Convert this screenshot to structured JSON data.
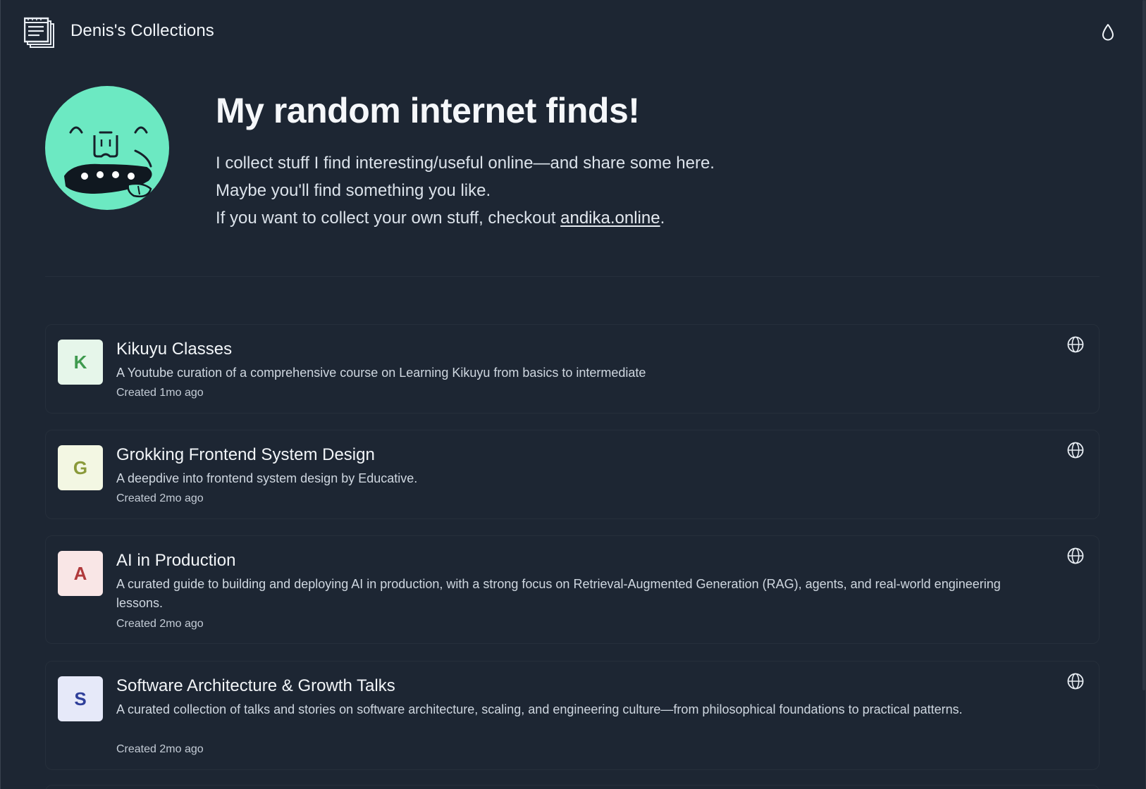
{
  "header": {
    "site_title": "Denis's Collections"
  },
  "hero": {
    "title": "My random internet finds!",
    "line1": "I collect stuff I find interesting/useful online—and share some here.",
    "line2": "Maybe you'll find something you like.",
    "line3_prefix": "If you want to collect your own stuff, checkout ",
    "link_text": "andika.online",
    "line3_suffix": "."
  },
  "collections": [
    {
      "initial": "K",
      "title": "Kikuyu Classes",
      "description": "A Youtube curation of a comprehensive course on Learning Kikuyu from basics to intermediate",
      "created": "Created 1mo ago",
      "badge_bg": "#e6f6ea",
      "badge_fg": "#3f9a4f",
      "visibility_icon": "globe-icon"
    },
    {
      "initial": "G",
      "title": "Grokking Frontend System Design",
      "description": "A deepdive into frontend system design by Educative.",
      "created": "Created 2mo ago",
      "badge_bg": "#f3f7e3",
      "badge_fg": "#8a9a3a",
      "visibility_icon": "globe-icon"
    },
    {
      "initial": "A",
      "title": "AI in Production",
      "description": "A curated guide to building and deploying AI in production, with a strong focus on Retrieval-Augmented Generation (RAG), agents, and real-world engineering lessons.",
      "created": "Created 2mo ago",
      "badge_bg": "#f9e6e6",
      "badge_fg": "#b0393b",
      "visibility_icon": "globe-icon"
    },
    {
      "initial": "S",
      "title": "Software Architecture & Growth Talks",
      "description": "A curated collection of talks and stories on software architecture, scaling, and engineering culture—from philosophical foundations to practical patterns.",
      "created": "Created 2mo ago",
      "badge_bg": "#e6e9f9",
      "badge_fg": "#2f3f9a",
      "visibility_icon": "globe-icon"
    }
  ],
  "colors": {
    "background": "#1d2633",
    "avatar": "#6ce9c2"
  }
}
